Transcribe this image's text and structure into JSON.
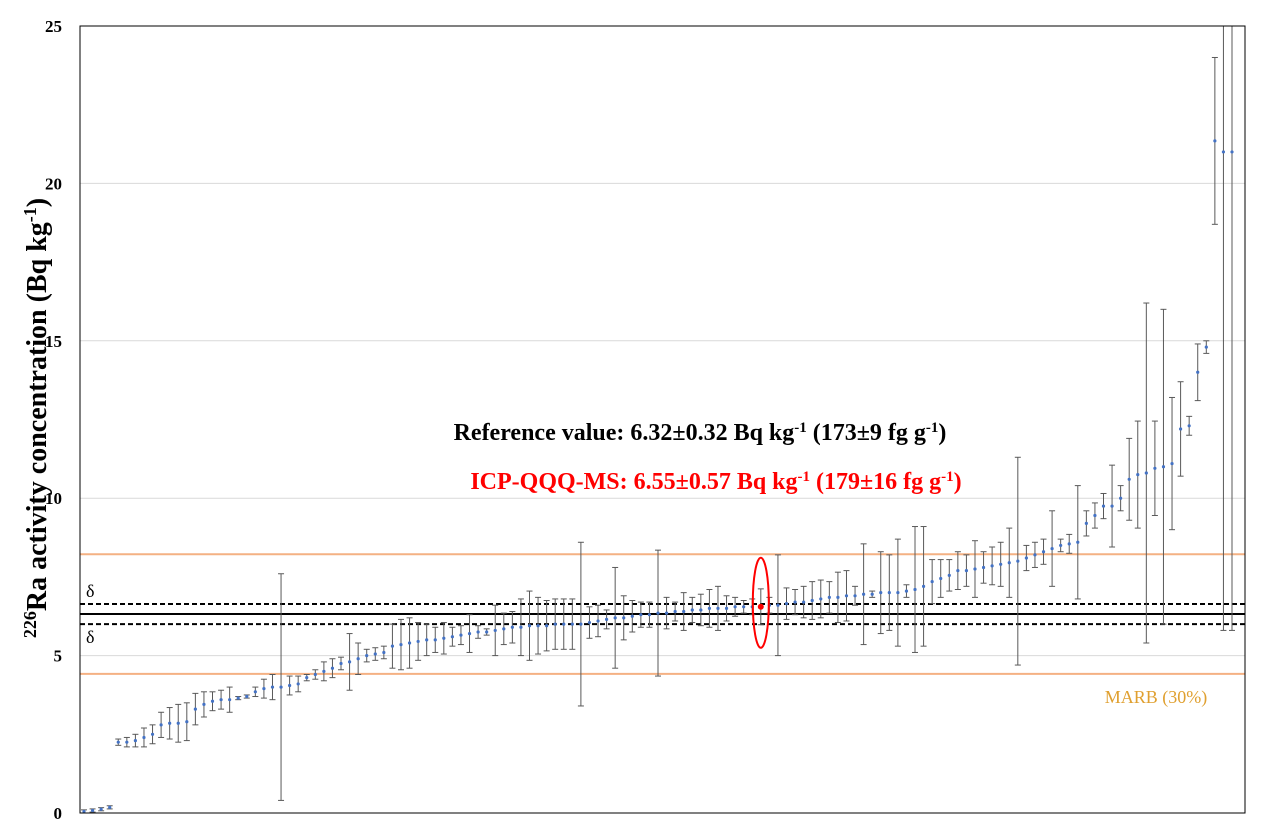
{
  "chart_data": {
    "type": "scatter",
    "title": "",
    "xlabel": "",
    "ylabel": {
      "sup": "226",
      "main": "Ra activity concentration (Bq kg",
      "unit_sup": "-1",
      "end": ")"
    },
    "ylim": [
      0,
      25
    ],
    "yticks": [
      "0",
      "5",
      "10",
      "15",
      "20",
      "25"
    ],
    "grid": "horizontal",
    "colors": {
      "points": "#4472C4",
      "errorbars": "#595959",
      "reference_line": "#000000",
      "marb": "#F4B183",
      "marb_text": "#E0A030",
      "highlight": "#FF0000",
      "grid": "#D9D9D9"
    },
    "reference": {
      "value": 6.32,
      "uncertainty": 0.32
    },
    "marb": {
      "label": "MARB (30%)",
      "upper": 8.22,
      "lower": 4.42
    },
    "delta_labels": {
      "upper": "δ",
      "lower": "δ"
    },
    "annotations": {
      "reference": {
        "prefix": "Reference value: 6.32±0.32 Bq kg",
        "sup1": "-1",
        "middle": " (173±9 fg g",
        "sup2": "-1",
        "end": ")"
      },
      "icp": {
        "prefix": "ICP-QQQ-MS: 6.55±0.57 Bq kg",
        "sup1": "-1",
        "middle": " (179±16 fg g",
        "sup2": "-1",
        "end": ")"
      }
    },
    "highlight": {
      "index": 79,
      "value": 6.55,
      "uncertainty": 0.57
    },
    "points": [
      {
        "y": 0.05,
        "e": 0.05
      },
      {
        "y": 0.08,
        "e": 0.05
      },
      {
        "y": 0.12,
        "e": 0.05
      },
      {
        "y": 0.18,
        "e": 0.05
      },
      {
        "y": 2.25,
        "e": 0.1
      },
      {
        "y": 2.25,
        "e": 0.15
      },
      {
        "y": 2.3,
        "e": 0.2
      },
      {
        "y": 2.4,
        "e": 0.3
      },
      {
        "y": 2.5,
        "e": 0.3
      },
      {
        "y": 2.8,
        "e": 0.4
      },
      {
        "y": 2.85,
        "e": 0.5
      },
      {
        "y": 2.85,
        "e": 0.6
      },
      {
        "y": 2.9,
        "e": 0.6
      },
      {
        "y": 3.3,
        "e": 0.5
      },
      {
        "y": 3.45,
        "e": 0.4
      },
      {
        "y": 3.55,
        "e": 0.3
      },
      {
        "y": 3.6,
        "e": 0.3
      },
      {
        "y": 3.6,
        "e": 0.4
      },
      {
        "y": 3.65,
        "e": 0.05
      },
      {
        "y": 3.7,
        "e": 0.05
      },
      {
        "y": 3.85,
        "e": 0.15
      },
      {
        "y": 3.95,
        "e": 0.3
      },
      {
        "y": 4.0,
        "e": 0.4
      },
      {
        "y": 4.0,
        "e": 3.6
      },
      {
        "y": 4.05,
        "e": 0.3
      },
      {
        "y": 4.1,
        "e": 0.25
      },
      {
        "y": 4.3,
        "e": 0.1
      },
      {
        "y": 4.4,
        "e": 0.15
      },
      {
        "y": 4.5,
        "e": 0.3
      },
      {
        "y": 4.6,
        "e": 0.3
      },
      {
        "y": 4.75,
        "e": 0.2
      },
      {
        "y": 4.8,
        "e": 0.9
      },
      {
        "y": 4.9,
        "e": 0.5
      },
      {
        "y": 5.0,
        "e": 0.2
      },
      {
        "y": 5.05,
        "e": 0.2
      },
      {
        "y": 5.1,
        "e": 0.2
      },
      {
        "y": 5.3,
        "e": 0.7
      },
      {
        "y": 5.35,
        "e": 0.8
      },
      {
        "y": 5.4,
        "e": 0.8
      },
      {
        "y": 5.45,
        "e": 0.6
      },
      {
        "y": 5.5,
        "e": 0.5
      },
      {
        "y": 5.5,
        "e": 0.4
      },
      {
        "y": 5.55,
        "e": 0.5
      },
      {
        "y": 5.6,
        "e": 0.3
      },
      {
        "y": 5.65,
        "e": 0.3
      },
      {
        "y": 5.7,
        "e": 0.6
      },
      {
        "y": 5.75,
        "e": 0.2
      },
      {
        "y": 5.75,
        "e": 0.1
      },
      {
        "y": 5.8,
        "e": 0.8
      },
      {
        "y": 5.85,
        "e": 0.5
      },
      {
        "y": 5.9,
        "e": 0.5
      },
      {
        "y": 5.9,
        "e": 0.9
      },
      {
        "y": 5.95,
        "e": 1.1
      },
      {
        "y": 5.95,
        "e": 0.9
      },
      {
        "y": 5.95,
        "e": 0.8
      },
      {
        "y": 6.0,
        "e": 0.8
      },
      {
        "y": 6.0,
        "e": 0.8
      },
      {
        "y": 6.0,
        "e": 0.8
      },
      {
        "y": 6.0,
        "e": 2.6
      },
      {
        "y": 6.05,
        "e": 0.5
      },
      {
        "y": 6.1,
        "e": 0.5
      },
      {
        "y": 6.15,
        "e": 0.3
      },
      {
        "y": 6.2,
        "e": 1.6
      },
      {
        "y": 6.2,
        "e": 0.7
      },
      {
        "y": 6.25,
        "e": 0.5
      },
      {
        "y": 6.3,
        "e": 0.4
      },
      {
        "y": 6.3,
        "e": 0.4
      },
      {
        "y": 6.35,
        "e": 2.0
      },
      {
        "y": 6.35,
        "e": 0.5
      },
      {
        "y": 6.4,
        "e": 0.3
      },
      {
        "y": 6.4,
        "e": 0.6
      },
      {
        "y": 6.45,
        "e": 0.4
      },
      {
        "y": 6.45,
        "e": 0.5
      },
      {
        "y": 6.5,
        "e": 0.6
      },
      {
        "y": 6.5,
        "e": 0.7
      },
      {
        "y": 6.5,
        "e": 0.4
      },
      {
        "y": 6.55,
        "e": 0.3
      },
      {
        "y": 6.55,
        "e": 0.2
      },
      {
        "y": 6.55,
        "e": 0.25
      },
      {
        "y": 6.55,
        "e": 0.57
      },
      {
        "y": 6.6,
        "e": 0.25
      },
      {
        "y": 6.6,
        "e": 1.6
      },
      {
        "y": 6.65,
        "e": 0.5
      },
      {
        "y": 6.7,
        "e": 0.4
      },
      {
        "y": 6.7,
        "e": 0.5
      },
      {
        "y": 6.75,
        "e": 0.6
      },
      {
        "y": 6.8,
        "e": 0.6
      },
      {
        "y": 6.85,
        "e": 0.5
      },
      {
        "y": 6.85,
        "e": 0.8
      },
      {
        "y": 6.9,
        "e": 0.8
      },
      {
        "y": 6.9,
        "e": 0.3
      },
      {
        "y": 6.95,
        "e": 1.6
      },
      {
        "y": 6.95,
        "e": 0.1
      },
      {
        "y": 7.0,
        "e": 1.3
      },
      {
        "y": 7.0,
        "e": 1.2
      },
      {
        "y": 7.0,
        "e": 1.7
      },
      {
        "y": 7.05,
        "e": 0.2
      },
      {
        "y": 7.1,
        "e": 2.0
      },
      {
        "y": 7.2,
        "e": 1.9
      },
      {
        "y": 7.35,
        "e": 0.7
      },
      {
        "y": 7.45,
        "e": 0.6
      },
      {
        "y": 7.55,
        "e": 0.5
      },
      {
        "y": 7.7,
        "e": 0.6
      },
      {
        "y": 7.7,
        "e": 0.5
      },
      {
        "y": 7.75,
        "e": 0.9
      },
      {
        "y": 7.8,
        "e": 0.5
      },
      {
        "y": 7.85,
        "e": 0.6
      },
      {
        "y": 7.9,
        "e": 0.7
      },
      {
        "y": 7.95,
        "e": 1.1
      },
      {
        "y": 8.0,
        "e": 3.3
      },
      {
        "y": 8.1,
        "e": 0.4
      },
      {
        "y": 8.2,
        "e": 0.4
      },
      {
        "y": 8.3,
        "e": 0.4
      },
      {
        "y": 8.4,
        "e": 1.2
      },
      {
        "y": 8.5,
        "e": 0.2
      },
      {
        "y": 8.55,
        "e": 0.3
      },
      {
        "y": 8.6,
        "e": 1.8
      },
      {
        "y": 9.2,
        "e": 0.4
      },
      {
        "y": 9.45,
        "e": 0.4
      },
      {
        "y": 9.75,
        "e": 0.4
      },
      {
        "y": 9.75,
        "e": 1.3
      },
      {
        "y": 10.0,
        "e": 0.4
      },
      {
        "y": 10.6,
        "e": 1.3
      },
      {
        "y": 10.75,
        "e": 1.7
      },
      {
        "y": 10.8,
        "e": 5.4
      },
      {
        "y": 10.95,
        "e": 1.5
      },
      {
        "y": 11.0,
        "e": 5.0
      },
      {
        "y": 11.1,
        "e": 2.1
      },
      {
        "y": 12.2,
        "e": 1.5
      },
      {
        "y": 12.3,
        "e": 0.3
      },
      {
        "y": 14.0,
        "e": 0.9
      },
      {
        "y": 14.8,
        "e": 0.2
      },
      {
        "y": 21.35,
        "e": 2.65
      },
      {
        "y": 21.0,
        "e": 15.2
      },
      {
        "y": 21.0,
        "e": 15.2
      }
    ]
  }
}
